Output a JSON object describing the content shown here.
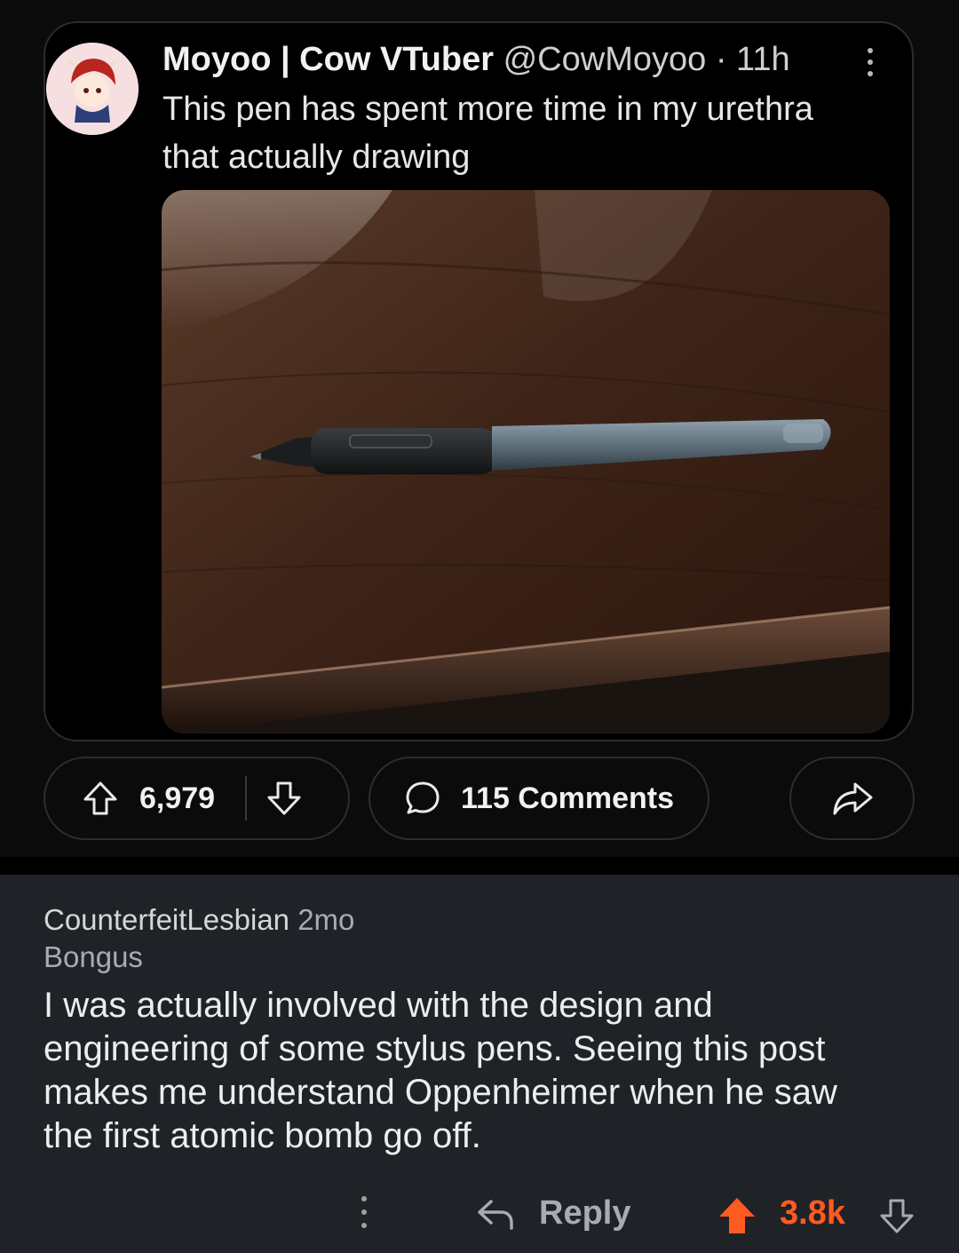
{
  "tweet": {
    "display_name": "Moyoo | Cow VTuber",
    "handle": "@CowMoyoo",
    "separator": "·",
    "time": "11h",
    "text": "This pen has spent more time in my urethra that actually drawing"
  },
  "post_actions": {
    "upvotes": "6,979",
    "comments_label": "115 Comments"
  },
  "comment": {
    "username": "CounterfeitLesbian",
    "age": "2mo",
    "flair": "Bongus",
    "body": "I was actually involved with the design and engineering of some stylus pens. Seeing this post makes me understand Oppenheimer when he saw the first atomic bomb go off.",
    "reply_label": "Reply",
    "score": "3.8k"
  },
  "icons": {
    "upvote": "arrow-up-outline-icon",
    "downvote": "arrow-down-outline-icon",
    "comments": "speech-bubble-icon",
    "share": "share-arrow-icon",
    "more": "vertical-ellipsis-icon",
    "reply": "reply-arrow-icon",
    "comment_upvote": "arrow-up-filled-icon"
  },
  "colors": {
    "background": "#000000",
    "comment_background": "#1f2227",
    "upvote_active": "#ff5a1f",
    "muted_text": "#a8abb0"
  }
}
